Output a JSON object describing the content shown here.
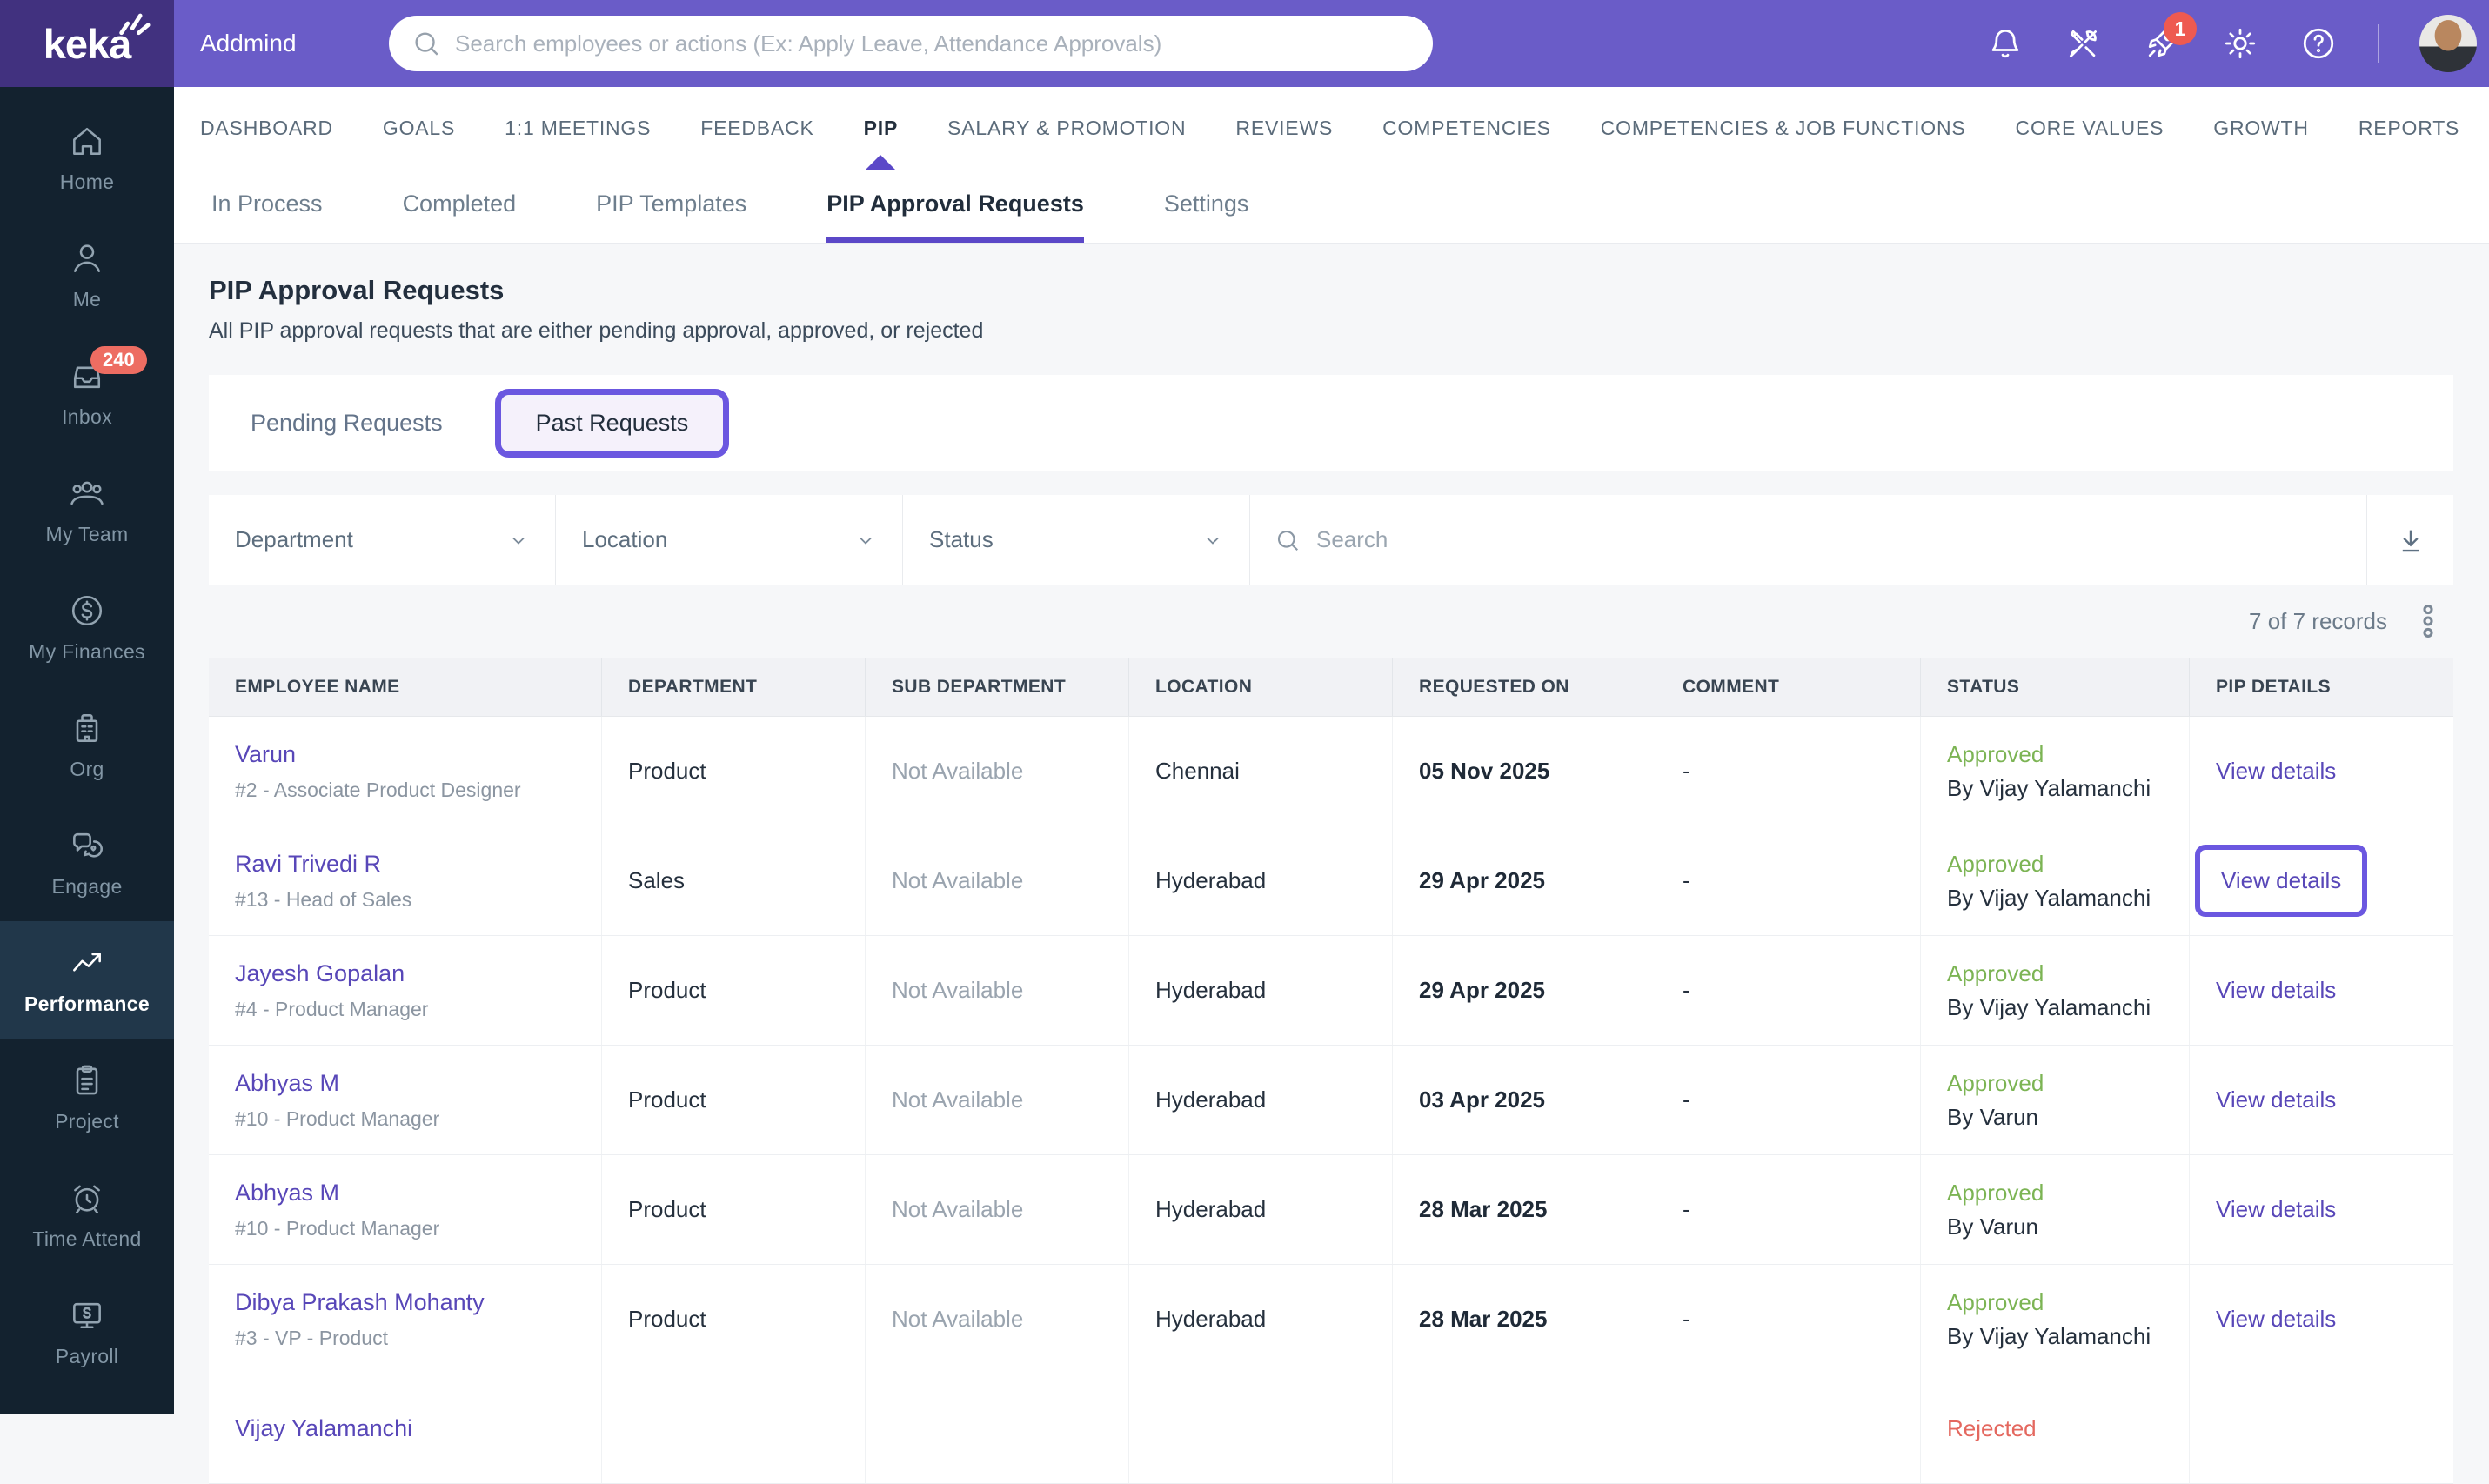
{
  "brand": {
    "logo_text": "keka",
    "company_name": "Addmind"
  },
  "topbar": {
    "search_placeholder": "Search employees or actions (Ex: Apply Leave, Attendance Approvals)",
    "whats_new_badge": "1",
    "icons": [
      "notifications-bell",
      "admin-tools",
      "whats-new",
      "settings-gear",
      "help",
      "avatar"
    ]
  },
  "sidebar": {
    "items": [
      {
        "label": "Home"
      },
      {
        "label": "Me"
      },
      {
        "label": "Inbox",
        "badge": "240"
      },
      {
        "label": "My Team"
      },
      {
        "label": "My Finances"
      },
      {
        "label": "Org"
      },
      {
        "label": "Engage"
      },
      {
        "label": "Performance",
        "active": true
      },
      {
        "label": "Project"
      },
      {
        "label": "Time Attend"
      },
      {
        "label": "Payroll"
      }
    ]
  },
  "nav": {
    "active": "PIP",
    "items": [
      {
        "label": "DASHBOARD"
      },
      {
        "label": "GOALS"
      },
      {
        "label": "1:1 MEETINGS"
      },
      {
        "label": "FEEDBACK"
      },
      {
        "label": "PIP",
        "active": true
      },
      {
        "label": "SALARY & PROMOTION"
      },
      {
        "label": "REVIEWS"
      },
      {
        "label": "COMPETENCIES"
      },
      {
        "label": "COMPETENCIES & JOB FUNCTIONS"
      },
      {
        "label": "CORE VALUES"
      },
      {
        "label": "GROWTH"
      },
      {
        "label": "REPORTS"
      }
    ]
  },
  "subnav": {
    "active": "PIP Approval Requests",
    "items": [
      {
        "label": "In Process"
      },
      {
        "label": "Completed"
      },
      {
        "label": "PIP Templates"
      },
      {
        "label": "PIP Approval Requests",
        "active": true
      },
      {
        "label": "Settings"
      }
    ]
  },
  "page": {
    "title": "PIP Approval Requests",
    "subtitle": "All PIP approval requests that are either pending approval, approved, or rejected"
  },
  "request_tabs": {
    "pending": "Pending Requests",
    "past": "Past Requests",
    "active": "Past Requests"
  },
  "filters": {
    "department_label": "Department",
    "location_label": "Location",
    "status_label": "Status",
    "search_placeholder": "Search"
  },
  "records_summary": "7 of 7 records",
  "table": {
    "columns": [
      "EMPLOYEE NAME",
      "DEPARTMENT",
      "SUB DEPARTMENT",
      "LOCATION",
      "REQUESTED ON",
      "COMMENT",
      "STATUS",
      "PIP DETAILS"
    ],
    "rows": [
      {
        "name": "Varun",
        "designation": "#2 - Associate Product Designer",
        "department": "Product",
        "sub_department": "Not Available",
        "location": "Chennai",
        "requested_on": "05 Nov 2025",
        "comment": "-",
        "status": "Approved",
        "status_by": "By Vijay Yalamanchi",
        "pip_details": "View details"
      },
      {
        "name": "Ravi Trivedi R",
        "designation": "#13 - Head of Sales",
        "department": "Sales",
        "sub_department": "Not Available",
        "location": "Hyderabad",
        "requested_on": "29 Apr 2025",
        "comment": "-",
        "status": "Approved",
        "status_by": "By Vijay Yalamanchi",
        "pip_details": "View details",
        "annotated": true
      },
      {
        "name": "Jayesh Gopalan",
        "designation": "#4 - Product Manager",
        "department": "Product",
        "sub_department": "Not Available",
        "location": "Hyderabad",
        "requested_on": "29 Apr 2025",
        "comment": "-",
        "status": "Approved",
        "status_by": "By Vijay Yalamanchi",
        "pip_details": "View details"
      },
      {
        "name": "Abhyas M",
        "designation": "#10 - Product Manager",
        "department": "Product",
        "sub_department": "Not Available",
        "location": "Hyderabad",
        "requested_on": "03 Apr 2025",
        "comment": "-",
        "status": "Approved",
        "status_by": "By Varun",
        "pip_details": "View details"
      },
      {
        "name": "Abhyas M",
        "designation": "#10 - Product Manager",
        "department": "Product",
        "sub_department": "Not Available",
        "location": "Hyderabad",
        "requested_on": "28 Mar 2025",
        "comment": "-",
        "status": "Approved",
        "status_by": "By Varun",
        "pip_details": "View details"
      },
      {
        "name": "Dibya Prakash Mohanty",
        "designation": "#3 - VP - Product",
        "department": "Product",
        "sub_department": "Not Available",
        "location": "Hyderabad",
        "requested_on": "28 Mar 2025",
        "comment": "-",
        "status": "Approved",
        "status_by": "By Vijay Yalamanchi",
        "pip_details": "View details"
      },
      {
        "name": "Vijay Yalamanchi",
        "designation": "",
        "department": "",
        "sub_department": "",
        "location": "",
        "requested_on": "",
        "comment": "",
        "status": "Rejected",
        "status_by": "",
        "pip_details": ""
      }
    ]
  },
  "colors": {
    "topbar_purple": "#6a5cc8",
    "logo_block_purple": "#41317f",
    "sidebar_navy": "#13222f",
    "annotation_purple": "#6b57e0",
    "accent_purple": "#5b48c8",
    "link_purple": "#5847b8",
    "approved_green": "#7cb454",
    "rejected_red": "#e4685f",
    "badge_red": "#ed6d62"
  }
}
